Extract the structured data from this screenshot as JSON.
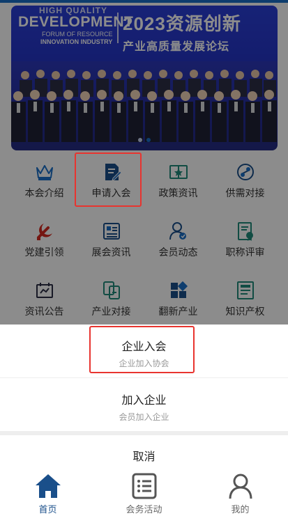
{
  "banner": {
    "line1": "HIGH QUALITY",
    "line2": "DEVELOPMENT",
    "line3": "FORUM OF RESOURCE",
    "line4": "INNOVATION INDUSTRY",
    "year_title": "2023资源创新",
    "subtitle": "产业高质量发展论坛",
    "dots": 2,
    "active_dot": 1
  },
  "grid": [
    {
      "label": "本会介绍",
      "icon": "crown-icon"
    },
    {
      "label": "申请入会",
      "icon": "document-edit-icon"
    },
    {
      "label": "政策资讯",
      "icon": "policy-book-icon"
    },
    {
      "label": "供需对接",
      "icon": "exchange-icon"
    },
    {
      "label": "党建引领",
      "icon": "party-emblem-icon"
    },
    {
      "label": "展会资讯",
      "icon": "exhibition-icon"
    },
    {
      "label": "会员动态",
      "icon": "member-icon"
    },
    {
      "label": "职称评审",
      "icon": "certificate-icon"
    },
    {
      "label": "资讯公告",
      "icon": "announcement-icon"
    },
    {
      "label": "产业对接",
      "icon": "industry-link-icon"
    },
    {
      "label": "翻新产业",
      "icon": "blocks-icon"
    },
    {
      "label": "知识产权",
      "icon": "ip-document-icon"
    }
  ],
  "sheet": {
    "option1": {
      "title": "企业入会",
      "subtitle": "企业加入协会"
    },
    "option2": {
      "title": "加入企业",
      "subtitle": "会员加入企业"
    },
    "cancel": "取消"
  },
  "tabbar": [
    {
      "label": "首页",
      "icon": "home-icon",
      "active": true
    },
    {
      "label": "会务活动",
      "icon": "list-icon",
      "active": false
    },
    {
      "label": "我的",
      "icon": "user-icon",
      "active": false
    }
  ],
  "colors": {
    "accent": "#1a6fc8",
    "highlight": "#e8342f",
    "tab_active": "#1a4f8a"
  }
}
